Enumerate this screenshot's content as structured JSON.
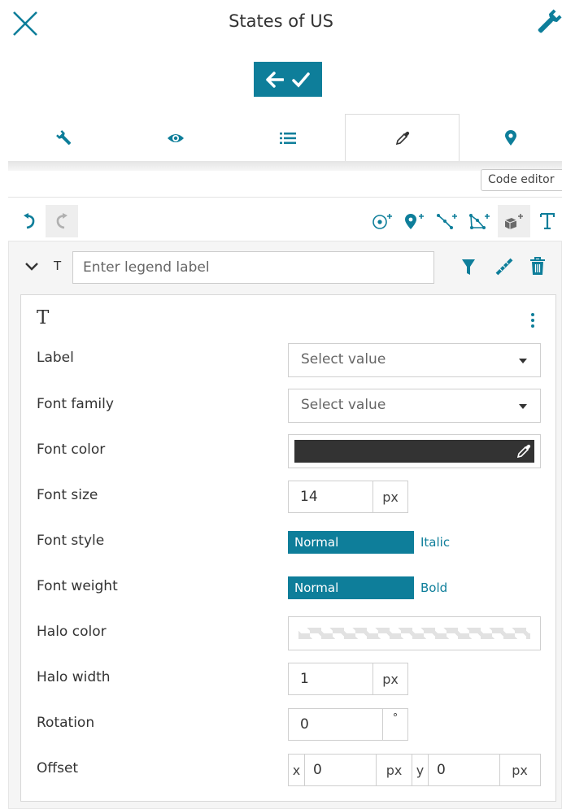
{
  "header": {
    "title": "States of US"
  },
  "tabs": [
    {
      "icon": "wrench-icon"
    },
    {
      "icon": "eye-icon"
    },
    {
      "icon": "list-icon"
    },
    {
      "icon": "eyedropper-icon",
      "active": true
    },
    {
      "icon": "map-marker-icon"
    }
  ],
  "code_editor_label": "Code editor",
  "legend": {
    "label_placeholder": "Enter legend label",
    "symbol_letter": "T"
  },
  "symbol": {
    "heading": "T",
    "rows": {
      "label": {
        "label": "Label",
        "value": "Select value"
      },
      "font_family": {
        "label": "Font family",
        "value": "Select value"
      },
      "font_color": {
        "label": "Font color",
        "value": "#333333"
      },
      "font_size": {
        "label": "Font size",
        "value": "14",
        "unit": "px"
      },
      "font_style": {
        "label": "Font style",
        "options": [
          "Normal",
          "Italic"
        ],
        "selected": "Normal"
      },
      "font_weight": {
        "label": "Font weight",
        "options": [
          "Normal",
          "Bold"
        ],
        "selected": "Normal"
      },
      "halo_color": {
        "label": "Halo color"
      },
      "halo_width": {
        "label": "Halo width",
        "value": "1",
        "unit": "px"
      },
      "rotation": {
        "label": "Rotation",
        "value": "0",
        "unit": "°"
      },
      "offset": {
        "label": "Offset",
        "x_label": "x",
        "x_value": "0",
        "x_unit": "px",
        "y_label": "y",
        "y_value": "0",
        "y_unit": "px"
      }
    }
  },
  "colors": {
    "accent": "#0e7e9a",
    "text": "#333333"
  }
}
